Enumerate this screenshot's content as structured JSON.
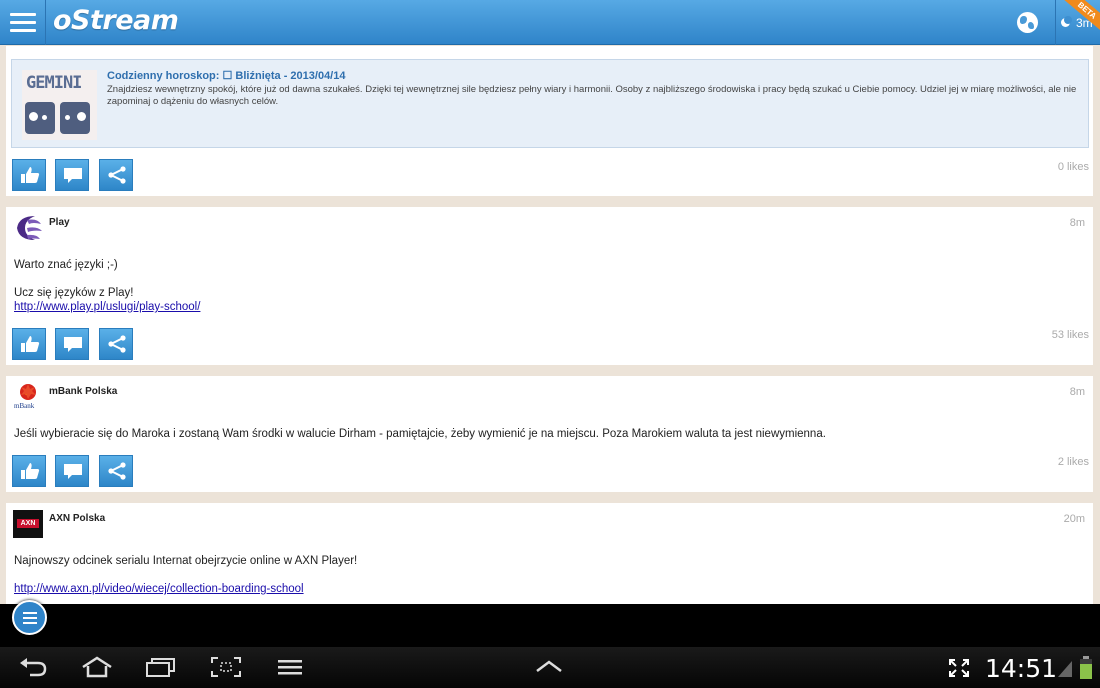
{
  "app": {
    "logo": "oStream",
    "refresh_age": "3m",
    "beta_ribbon": "BETA"
  },
  "horoscope": {
    "image_title": "GEMINI",
    "heading": "Codzienny horoskop: ☐ Bliźnięta - 2013/04/14",
    "body": "Znajdziesz wewnętrzny spokój, które już od dawna szukałeś. Dzięki tej wewnętrznej sile będziesz pełny wiary i harmonii. Osoby z najbliższego środowiska i pracy będą szukać u Ciebie pomocy. Udziel jej w miarę możliwości, ale nie zapominaj o dążeniu do własnych celów.",
    "likes": "0 likes"
  },
  "posts": [
    {
      "author": "Play",
      "age": "8m",
      "line1": "Warto znać języki ;-)",
      "line2": "Ucz się języków z Play!",
      "link": "http://www.play.pl/uslugi/play-school/",
      "likes": "53 likes"
    },
    {
      "author": "mBank Polska",
      "age": "8m",
      "avatar_text": "mBank",
      "line1": "Jeśli wybieracie się do Maroka i zostaną Wam środki w walucie Dirham - pamiętajcie, żeby wymienić je na miejscu. Poza Marokiem waluta ta jest niewymienna.",
      "likes": "2 likes"
    },
    {
      "author": "AXN Polska",
      "age": "20m",
      "avatar_text": "AXN",
      "line1": "Najnowszy odcinek serialu Internat obejrzycie online w AXN Player!",
      "link": "http://www.axn.pl/video/wiecej/collection-boarding-school"
    }
  ],
  "system": {
    "clock": "14:51"
  },
  "icons": {
    "like": "thumbs-up-icon",
    "comment": "comment-icon",
    "share": "share-icon"
  },
  "colors": {
    "accent": "#2f84c9",
    "link": "#1a0dab",
    "beta": "#f08a1c",
    "feed_bg": "#ece3d8"
  }
}
